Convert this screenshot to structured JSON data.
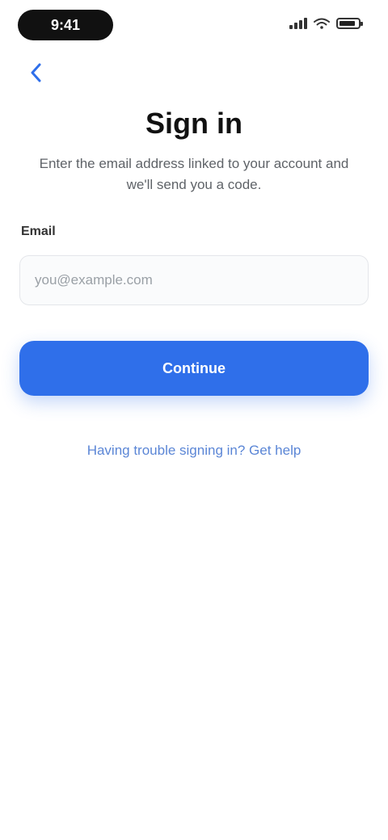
{
  "status_bar": {
    "time": "9:41",
    "battery_level": 0.85
  },
  "icons": {
    "back": "chevron-left-icon",
    "signal": "signal-icon",
    "wifi": "wifi-icon",
    "battery": "battery-icon"
  },
  "header": {
    "title": "Sign in",
    "subtitle": "Enter the email address linked to your account and we'll send you a code."
  },
  "form": {
    "email_label": "Email",
    "email_value": "",
    "email_placeholder": "you@example.com"
  },
  "actions": {
    "continue_label": "Continue",
    "help_link": "Having trouble signing in? Get help"
  },
  "colors": {
    "accent": "#2f6fea",
    "link": "#5b86d6",
    "subtitle": "#5f6368"
  }
}
